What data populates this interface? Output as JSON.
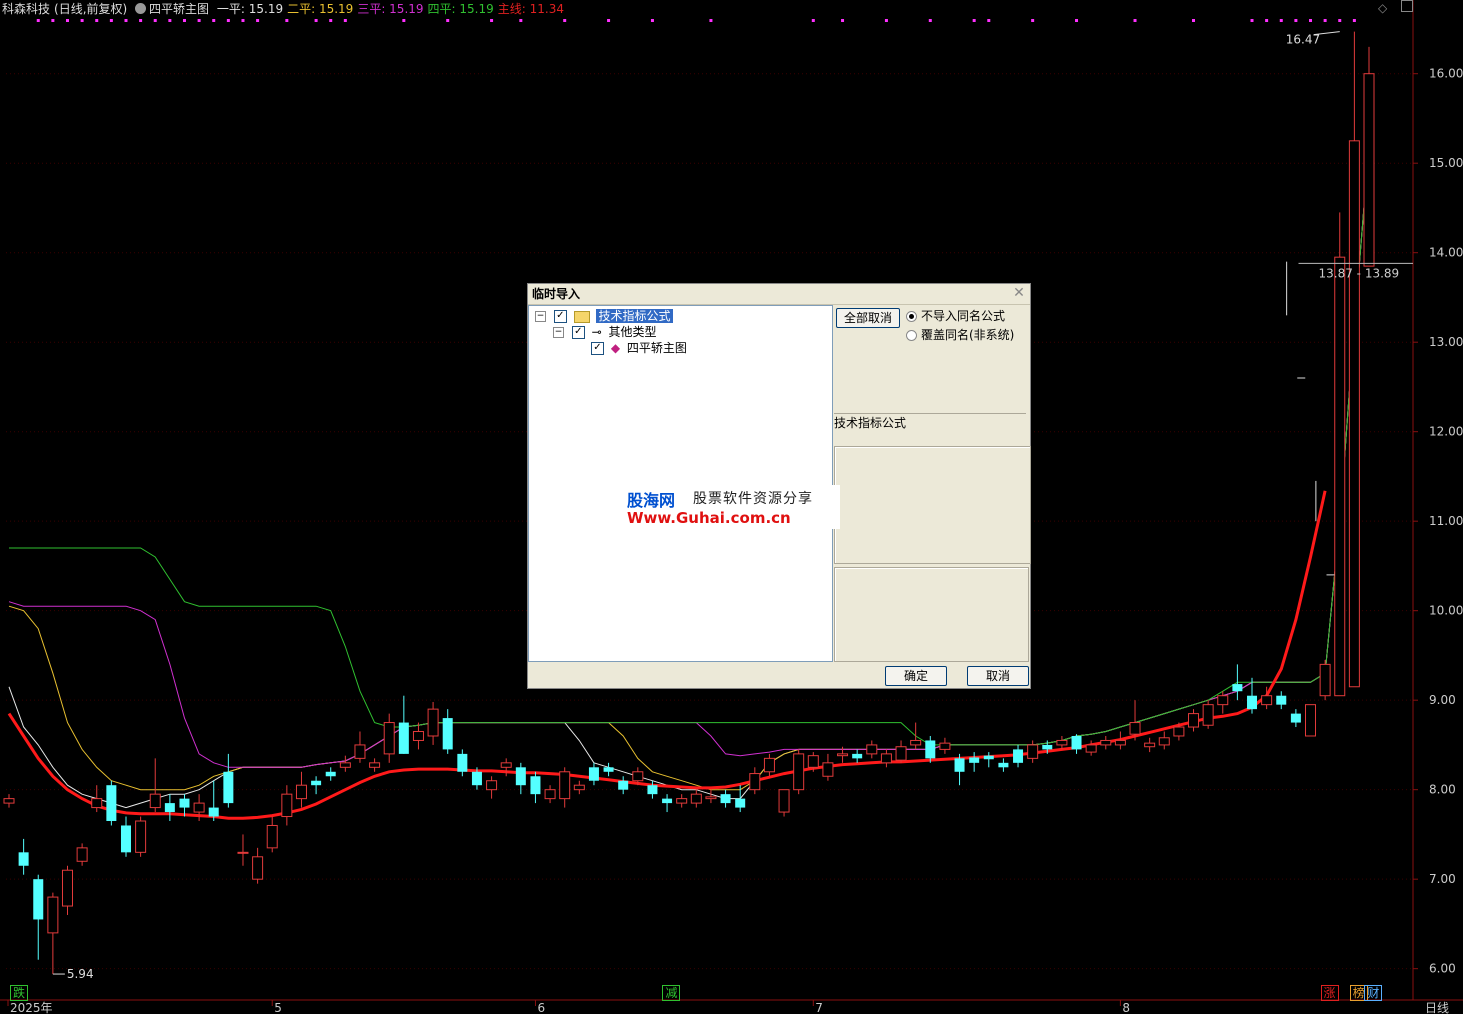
{
  "header": {
    "stock": "科森科技",
    "mode": "(日线,前复权)",
    "indicator": "四平轿主图",
    "items": [
      {
        "label": "一平:",
        "value": "15.19",
        "color": "#e0e0e0"
      },
      {
        "label": "二平:",
        "value": "15.19",
        "color": "#e8c030"
      },
      {
        "label": "三平:",
        "value": "15.19",
        "color": "#d030d0"
      },
      {
        "label": "四平:",
        "value": "15.19",
        "color": "#30c030"
      },
      {
        "label": "主线:",
        "value": "11.34",
        "color": "#e02020"
      }
    ]
  },
  "price_axis": {
    "ticks": [
      "16.00",
      "15.00",
      "14.00",
      "13.00",
      "12.00",
      "11.00",
      "10.00",
      "9.00",
      "8.00",
      "7.00",
      "6.00"
    ],
    "range": [
      5.65,
      16.6
    ]
  },
  "time_axis": {
    "labels": [
      {
        "text": "2025年",
        "idx": 0
      },
      {
        "text": "5",
        "idx": 18
      },
      {
        "text": "6",
        "idx": 36
      },
      {
        "text": "7",
        "idx": 55
      },
      {
        "text": "8",
        "idx": 76
      }
    ],
    "period": "日线"
  },
  "annotations": {
    "high": "16.47",
    "low": "5.94",
    "range_label": "13.87 - 13.89"
  },
  "bottom_tags": [
    {
      "text": "跌",
      "color": "#30c030",
      "idx": 0
    },
    {
      "text": "减",
      "color": "#30c030",
      "idx": 44
    },
    {
      "text": "涨",
      "color": "#e02020",
      "idx": 89
    },
    {
      "text": "榜",
      "color": "#e8a030",
      "idx": 91
    },
    {
      "text": "财",
      "color": "#5ab0ff",
      "idx": 92
    }
  ],
  "colors": {
    "up": "#e23b3b",
    "down": "#54ffff",
    "main_line": "#ff1a1a",
    "line1": "#e8e8e8",
    "line2": "#e8c030",
    "line3": "#d030d0",
    "line4": "#30c030",
    "grid": "#3a0000",
    "signal_dot": "#ff30ff"
  },
  "chart_data": {
    "type": "candlestick",
    "x": [
      0,
      1,
      2,
      3,
      4,
      5,
      6,
      7,
      8,
      9,
      10,
      11,
      12,
      13,
      14,
      15,
      16,
      17,
      18,
      19,
      20,
      21,
      22,
      23,
      24,
      25,
      26,
      27,
      28,
      29,
      30,
      31,
      32,
      33,
      34,
      35,
      36,
      37,
      38,
      39,
      40,
      41,
      42,
      43,
      44,
      45,
      46,
      47,
      48,
      49,
      50,
      51,
      52,
      53,
      54,
      55,
      56,
      57,
      58,
      59,
      60,
      61,
      62,
      63,
      64,
      65,
      66,
      67,
      68,
      69,
      70,
      71,
      72,
      73,
      74,
      75,
      76,
      77,
      78,
      79,
      80,
      81,
      82,
      83,
      84,
      85,
      86,
      87,
      88,
      89,
      90,
      91,
      92,
      93
    ],
    "open": [
      7.85,
      7.3,
      7.0,
      6.4,
      6.7,
      7.2,
      7.8,
      8.05,
      7.6,
      7.3,
      7.8,
      7.85,
      7.9,
      7.75,
      7.8,
      8.2,
      7.3,
      7.0,
      7.35,
      7.7,
      7.9,
      8.1,
      8.2,
      8.25,
      8.35,
      8.25,
      8.4,
      8.75,
      8.55,
      8.6,
      8.8,
      8.4,
      8.2,
      8.0,
      8.25,
      8.25,
      8.15,
      7.9,
      7.9,
      8.0,
      8.25,
      8.25,
      8.1,
      8.1,
      8.05,
      7.9,
      7.85,
      7.85,
      7.9,
      7.95,
      7.9,
      8.0,
      8.2,
      7.75,
      8.0,
      8.25,
      8.15,
      8.38,
      8.4,
      8.4,
      8.3,
      8.33,
      8.5,
      8.55,
      8.45,
      8.35,
      8.36,
      8.38,
      8.3,
      8.45,
      8.35,
      8.5,
      8.5,
      8.6,
      8.42,
      8.5,
      8.5,
      8.62,
      8.48,
      8.5,
      8.6,
      8.7,
      8.72,
      8.95,
      9.18,
      9.05,
      8.95,
      9.05,
      8.85,
      8.6,
      9.05,
      9.05,
      9.15,
      13.85
    ],
    "close": [
      7.9,
      7.15,
      6.55,
      6.8,
      7.1,
      7.35,
      7.9,
      7.65,
      7.3,
      7.65,
      7.95,
      7.75,
      7.8,
      7.85,
      7.7,
      7.85,
      7.3,
      7.25,
      7.6,
      7.95,
      8.05,
      8.05,
      8.15,
      8.3,
      8.5,
      8.3,
      8.75,
      8.4,
      8.65,
      8.9,
      8.45,
      8.2,
      8.05,
      8.1,
      8.3,
      8.05,
      7.95,
      8.0,
      8.2,
      8.05,
      8.1,
      8.2,
      8.0,
      8.2,
      7.95,
      7.85,
      7.9,
      7.95,
      7.92,
      7.85,
      7.8,
      8.18,
      8.35,
      8.0,
      8.4,
      8.38,
      8.3,
      8.4,
      8.35,
      8.5,
      8.4,
      8.48,
      8.55,
      8.35,
      8.52,
      8.2,
      8.3,
      8.34,
      8.25,
      8.3,
      8.5,
      8.45,
      8.55,
      8.45,
      8.5,
      8.55,
      8.55,
      8.75,
      8.52,
      8.58,
      8.7,
      8.85,
      8.95,
      9.05,
      9.1,
      8.9,
      9.05,
      8.95,
      8.75,
      8.95,
      9.4,
      13.95,
      15.25,
      16.0
    ],
    "high": [
      7.95,
      7.45,
      7.05,
      6.85,
      7.15,
      7.4,
      8.05,
      8.1,
      7.7,
      7.7,
      8.35,
      7.95,
      7.95,
      7.95,
      8.1,
      8.4,
      7.5,
      7.35,
      7.7,
      8.05,
      8.2,
      8.15,
      8.25,
      8.38,
      8.65,
      8.35,
      8.85,
      9.05,
      8.75,
      8.98,
      8.9,
      8.45,
      8.25,
      8.15,
      8.35,
      8.3,
      8.2,
      8.05,
      8.25,
      8.1,
      8.3,
      8.3,
      8.15,
      8.25,
      8.1,
      7.95,
      7.95,
      8.0,
      8.0,
      8.0,
      8.05,
      8.25,
      8.4,
      8.0,
      8.45,
      8.42,
      8.4,
      8.48,
      8.45,
      8.55,
      8.45,
      8.55,
      8.75,
      8.6,
      8.58,
      8.4,
      8.42,
      8.42,
      8.35,
      8.5,
      8.55,
      8.55,
      8.6,
      8.62,
      8.55,
      8.6,
      8.65,
      9.0,
      8.58,
      8.65,
      8.75,
      8.9,
      9.0,
      9.1,
      9.4,
      9.25,
      9.15,
      9.1,
      8.9,
      8.7,
      9.45,
      14.45,
      16.47,
      16.3
    ],
    "low": [
      7.8,
      7.05,
      6.1,
      5.94,
      6.6,
      7.15,
      7.75,
      7.6,
      7.25,
      7.25,
      7.75,
      7.65,
      7.7,
      7.65,
      7.65,
      7.8,
      7.15,
      6.95,
      7.3,
      7.6,
      7.8,
      7.95,
      8.1,
      8.2,
      8.3,
      8.2,
      8.3,
      8.4,
      8.45,
      8.5,
      8.4,
      8.15,
      8.0,
      7.9,
      8.15,
      7.95,
      7.85,
      7.85,
      7.8,
      7.95,
      8.05,
      8.15,
      7.95,
      8.05,
      7.9,
      7.75,
      7.8,
      7.8,
      7.85,
      7.8,
      7.75,
      7.95,
      8.15,
      7.7,
      7.95,
      8.2,
      8.1,
      8.3,
      8.3,
      8.35,
      8.25,
      8.3,
      8.45,
      8.3,
      8.4,
      8.05,
      8.2,
      8.25,
      8.2,
      8.25,
      8.3,
      8.4,
      8.45,
      8.4,
      8.38,
      8.45,
      8.45,
      8.55,
      8.42,
      8.45,
      8.55,
      8.65,
      8.68,
      8.85,
      9.0,
      8.85,
      8.9,
      8.9,
      8.7,
      8.6,
      9.0,
      13.5,
      14.85,
      15.0
    ],
    "series": [
      {
        "name": "一平",
        "values": [
          9.15,
          8.7,
          8.5,
          8.25,
          8.05,
          7.95,
          7.9,
          7.85,
          7.8,
          7.85,
          7.9,
          7.95,
          7.95,
          8.0,
          8.1,
          8.2,
          8.25,
          8.25,
          8.25,
          8.25,
          8.25,
          8.28,
          8.3,
          8.32,
          8.4,
          8.5,
          8.6,
          8.7,
          8.72,
          8.75,
          8.75,
          8.75,
          8.75,
          8.75,
          8.75,
          8.75,
          8.75,
          8.75,
          8.75,
          8.55,
          8.3,
          8.25,
          8.2,
          8.15,
          8.1,
          8.05,
          8.0,
          8.0,
          7.95,
          7.9,
          7.9,
          8.1,
          8.3,
          8.4,
          8.45,
          8.45,
          8.45,
          8.45,
          8.45,
          8.45,
          8.45,
          8.45,
          8.45,
          8.45,
          8.5,
          8.5,
          8.5,
          8.5,
          8.5,
          8.5,
          8.5,
          8.52,
          8.55,
          8.6,
          8.62,
          8.65,
          8.7,
          8.75,
          8.8,
          8.85,
          8.9,
          8.95,
          9.0,
          9.05,
          9.1,
          9.2,
          9.2,
          9.2,
          9.2,
          9.2,
          9.3,
          11.0,
          13.2,
          15.19
        ]
      },
      {
        "name": "二平",
        "values": [
          10.05,
          10.0,
          9.8,
          9.3,
          8.75,
          8.45,
          8.25,
          8.1,
          8.05,
          8.0,
          8.0,
          8.0,
          8.0,
          8.05,
          8.15,
          8.2,
          8.25,
          8.25,
          8.25,
          8.25,
          8.25,
          8.28,
          8.3,
          8.32,
          8.4,
          8.5,
          8.6,
          8.7,
          8.72,
          8.75,
          8.75,
          8.75,
          8.75,
          8.75,
          8.75,
          8.75,
          8.75,
          8.75,
          8.75,
          8.75,
          8.75,
          8.75,
          8.6,
          8.35,
          8.2,
          8.15,
          8.1,
          8.05,
          8.0,
          8.0,
          8.0,
          8.1,
          8.3,
          8.4,
          8.45,
          8.45,
          8.45,
          8.45,
          8.45,
          8.45,
          8.45,
          8.45,
          8.45,
          8.45,
          8.5,
          8.5,
          8.5,
          8.5,
          8.5,
          8.5,
          8.5,
          8.52,
          8.55,
          8.6,
          8.62,
          8.65,
          8.7,
          8.75,
          8.8,
          8.85,
          8.9,
          8.95,
          9.0,
          9.05,
          9.1,
          9.2,
          9.2,
          9.2,
          9.2,
          9.2,
          9.3,
          11.0,
          13.2,
          15.19
        ]
      },
      {
        "name": "三平",
        "values": [
          10.1,
          10.05,
          10.05,
          10.05,
          10.05,
          10.05,
          10.05,
          10.05,
          10.05,
          10.0,
          9.9,
          9.4,
          8.8,
          8.4,
          8.3,
          8.25,
          8.25,
          8.25,
          8.25,
          8.25,
          8.25,
          8.28,
          8.3,
          8.32,
          8.4,
          8.5,
          8.6,
          8.7,
          8.72,
          8.75,
          8.75,
          8.75,
          8.75,
          8.75,
          8.75,
          8.75,
          8.75,
          8.75,
          8.75,
          8.75,
          8.75,
          8.75,
          8.75,
          8.75,
          8.75,
          8.75,
          8.75,
          8.75,
          8.6,
          8.4,
          8.38,
          8.4,
          8.42,
          8.45,
          8.45,
          8.45,
          8.45,
          8.45,
          8.45,
          8.45,
          8.45,
          8.45,
          8.45,
          8.45,
          8.5,
          8.5,
          8.5,
          8.5,
          8.5,
          8.5,
          8.5,
          8.52,
          8.55,
          8.6,
          8.62,
          8.65,
          8.7,
          8.75,
          8.8,
          8.85,
          8.9,
          8.95,
          9.0,
          9.05,
          9.1,
          9.2,
          9.2,
          9.2,
          9.2,
          9.2,
          9.3,
          11.0,
          13.2,
          15.19
        ]
      },
      {
        "name": "四平",
        "values": [
          10.7,
          10.7,
          10.7,
          10.7,
          10.7,
          10.7,
          10.7,
          10.7,
          10.7,
          10.7,
          10.6,
          10.35,
          10.1,
          10.05,
          10.05,
          10.05,
          10.05,
          10.05,
          10.05,
          10.05,
          10.05,
          10.05,
          10.0,
          9.6,
          9.1,
          8.75,
          8.7,
          8.7,
          8.72,
          8.75,
          8.75,
          8.75,
          8.75,
          8.75,
          8.75,
          8.75,
          8.75,
          8.75,
          8.75,
          8.75,
          8.75,
          8.75,
          8.75,
          8.75,
          8.75,
          8.75,
          8.75,
          8.75,
          8.75,
          8.75,
          8.75,
          8.75,
          8.75,
          8.75,
          8.75,
          8.75,
          8.75,
          8.75,
          8.75,
          8.75,
          8.75,
          8.75,
          8.6,
          8.5,
          8.5,
          8.5,
          8.5,
          8.5,
          8.5,
          8.5,
          8.5,
          8.52,
          8.55,
          8.6,
          8.62,
          8.65,
          8.7,
          8.75,
          8.8,
          8.85,
          8.9,
          8.95,
          9.0,
          9.1,
          9.2,
          9.2,
          9.2,
          9.2,
          9.2,
          9.2,
          9.3,
          11.0,
          13.2,
          15.19
        ]
      },
      {
        "name": "主线",
        "values": [
          8.85,
          8.6,
          8.35,
          8.15,
          8.0,
          7.9,
          7.82,
          7.77,
          7.74,
          7.73,
          7.73,
          7.73,
          7.72,
          7.71,
          7.7,
          7.68,
          7.68,
          7.69,
          7.71,
          7.74,
          7.78,
          7.84,
          7.92,
          8.0,
          8.08,
          8.15,
          8.2,
          8.22,
          8.23,
          8.23,
          8.23,
          8.22,
          8.21,
          8.21,
          8.2,
          8.19,
          8.19,
          8.18,
          8.17,
          8.15,
          8.13,
          8.11,
          8.09,
          8.07,
          8.05,
          8.04,
          8.03,
          8.02,
          8.02,
          8.03,
          8.06,
          8.1,
          8.14,
          8.18,
          8.21,
          8.24,
          8.26,
          8.28,
          8.29,
          8.3,
          8.31,
          8.31,
          8.32,
          8.33,
          8.34,
          8.35,
          8.36,
          8.37,
          8.38,
          8.39,
          8.41,
          8.43,
          8.45,
          8.47,
          8.5,
          8.53,
          8.56,
          8.6,
          8.64,
          8.68,
          8.72,
          8.76,
          8.8,
          8.82,
          8.85,
          8.92,
          9.05,
          9.35,
          9.9,
          10.6,
          11.34
        ]
      }
    ]
  },
  "dialog": {
    "title": "临时导入",
    "tree": [
      {
        "label": "技术指标公式",
        "level": 0,
        "checked": true,
        "selected": true
      },
      {
        "label": "其他类型",
        "level": 1,
        "checked": true,
        "selected": false
      },
      {
        "label": "四平轿主图",
        "level": 2,
        "checked": true,
        "selected": false
      }
    ],
    "cancel_all": "全部取消",
    "radio_options": [
      {
        "label": "不导入同名公式",
        "checked": true
      },
      {
        "label": "覆盖同名(非系统)",
        "checked": false
      }
    ],
    "info_label": "技术指标公式",
    "ok": "确定",
    "cancel": "取消"
  },
  "watermark": {
    "brand": "股海网",
    "slogan": "股票软件资源分享",
    "url": "Www.Guhai.com.cn"
  }
}
